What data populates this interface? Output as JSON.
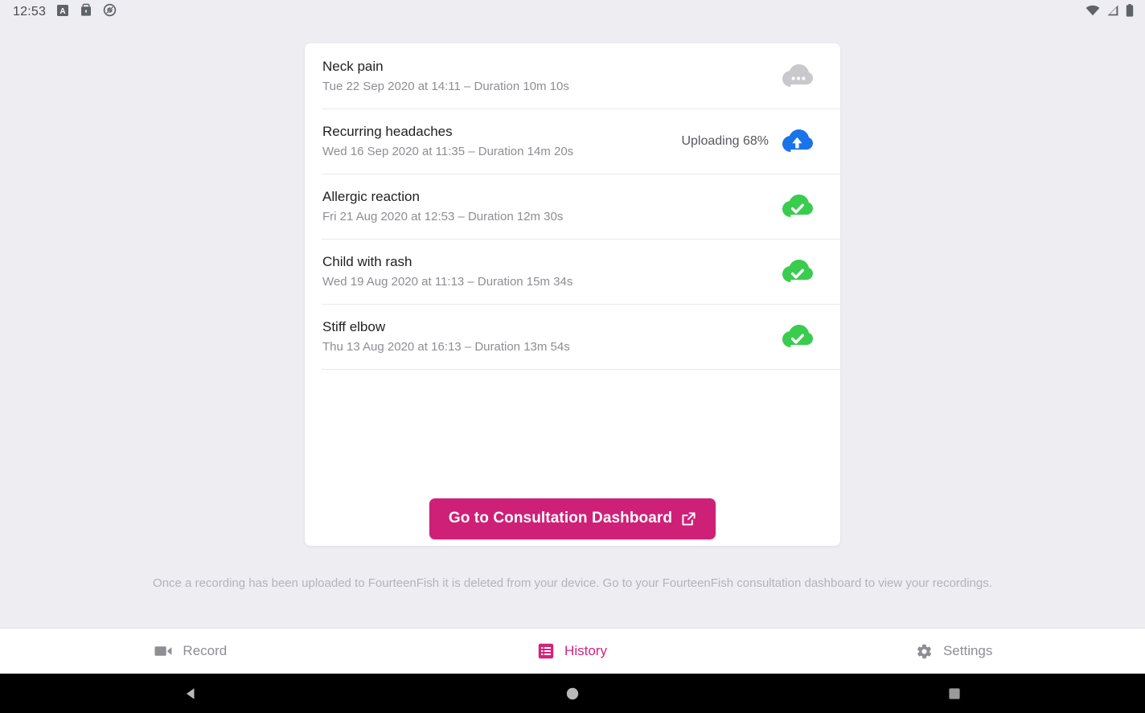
{
  "status_bar": {
    "clock": "12:53",
    "left_icons": [
      {
        "name": "font-size-a-icon"
      },
      {
        "name": "briefcase-icon"
      },
      {
        "name": "do-not-disturb-icon"
      }
    ],
    "right_icons": [
      {
        "name": "wifi-icon"
      },
      {
        "name": "cellular-signal-icon"
      },
      {
        "name": "battery-icon"
      }
    ]
  },
  "recordings": [
    {
      "title": "Neck pain",
      "subtitle": "Tue 22 Sep 2020 at 14:11 – Duration 10m 10s",
      "status_label": "",
      "status_icon": "cloud-pending-icon",
      "status_color": "#c8c8cd"
    },
    {
      "title": "Recurring headaches",
      "subtitle": "Wed 16 Sep 2020 at 11:35 – Duration 14m 20s",
      "status_label": "Uploading 68%",
      "status_icon": "cloud-uploading-icon",
      "status_color": "#1a73e8"
    },
    {
      "title": "Allergic reaction",
      "subtitle": "Fri 21 Aug 2020 at 12:53 – Duration 12m 30s",
      "status_label": "",
      "status_icon": "cloud-uploaded-icon",
      "status_color": "#39cc4f"
    },
    {
      "title": "Child with rash",
      "subtitle": "Wed 19 Aug 2020 at 11:13 – Duration 15m 34s",
      "status_label": "",
      "status_icon": "cloud-uploaded-icon",
      "status_color": "#39cc4f"
    },
    {
      "title": "Stiff elbow",
      "subtitle": "Thu 13 Aug 2020 at 16:13 – Duration 13m 54s",
      "status_label": "",
      "status_icon": "cloud-uploaded-icon",
      "status_color": "#39cc4f"
    }
  ],
  "cta": {
    "label": "Go to Consultation Dashboard",
    "icon": "external-link-icon",
    "color": "#cf2077"
  },
  "footer_note": "Once a recording has been uploaded to FourteenFish it is deleted from your device. Go to your FourteenFish consultation dashboard to view your recordings.",
  "tabs": [
    {
      "label": "Record",
      "icon": "video-camera-icon",
      "active": false
    },
    {
      "label": "History",
      "icon": "list-icon",
      "active": true
    },
    {
      "label": "Settings",
      "icon": "gear-icon",
      "active": false
    }
  ],
  "accent_color": "#d5227c",
  "nav_bar": [
    {
      "name": "android-back-button"
    },
    {
      "name": "android-home-button"
    },
    {
      "name": "android-recents-button"
    }
  ]
}
